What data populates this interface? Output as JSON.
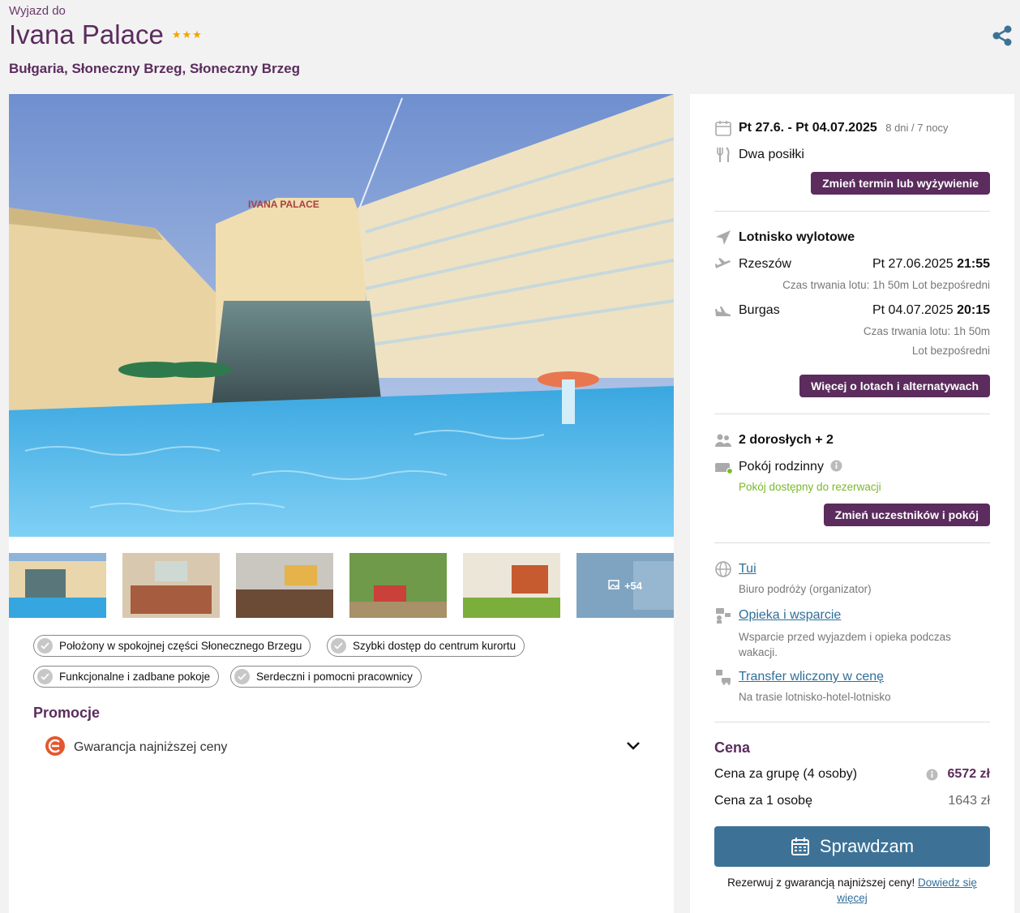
{
  "header": {
    "trip_label": "Wyjazd do",
    "hotel_name": "Ivana Palace",
    "stars": "★★★",
    "location": "Bułgaria, Słoneczny Brzeg, Słoneczny Brzeg"
  },
  "gallery": {
    "more_count": "+54"
  },
  "highlights": [
    "Położony w spokojnej części Słonecznego Brzegu",
    "Szybki dostęp do centrum kurortu",
    "Funkcjonalne i zadbane pokoje",
    "Serdeczni i pomocni pracownicy"
  ],
  "promo": {
    "title": "Promocje",
    "item": "Gwarancja najniższej ceny"
  },
  "booking": {
    "dates": "Pt 27.6. - Pt 04.07.2025",
    "duration": "8 dni / 7 nocy",
    "board": "Dwa posiłki",
    "change_date_btn": "Zmień termin lub wyżywienie",
    "airport_title": "Lotnisko wylotowe",
    "outbound": {
      "city": "Rzeszów",
      "date": "Pt 27.06.2025",
      "time": "21:55",
      "info": "Czas trwania lotu: 1h 50m  Lot bezpośredni"
    },
    "inbound": {
      "city": "Burgas",
      "date": "Pt 04.07.2025",
      "time": "20:15",
      "duration": "Czas trwania lotu: 1h 50m",
      "direct": "Lot bezpośredni"
    },
    "flights_btn": "Więcej o lotach i alternatywach",
    "travellers": "2 dorosłych + 2",
    "room": "Pokój rodzinny",
    "room_status": "Pokój dostępny do rezerwacji",
    "change_travellers_btn": "Zmień uczestników i pokój",
    "organizer_link": "Tui",
    "organizer_desc": "Biuro podróży (organizator)",
    "support_link": "Opieka i wsparcie",
    "support_desc": "Wsparcie przed wyjazdem i opieka podczas wakacji.",
    "transfer_link": "Transfer wliczony w cenę",
    "transfer_desc": "Na trasie lotnisko-hotel-lotnisko",
    "price_title": "Cena",
    "group_price_label": "Cena za grupę (4 osoby)",
    "group_price": "6572 zł",
    "person_price_label": "Cena za 1 osobę",
    "person_price": "1643 zł",
    "cta": "Sprawdzam",
    "guarantee_text": "Rezerwuj z gwarancją najniższej ceny!",
    "guarantee_link1": "Dowiedz się",
    "guarantee_link2": "więcej"
  },
  "colors": {
    "brand_purple": "#5b2c5d",
    "cta_blue": "#3d7296",
    "available_green": "#7ab929",
    "link_blue": "#2f6f9a"
  }
}
